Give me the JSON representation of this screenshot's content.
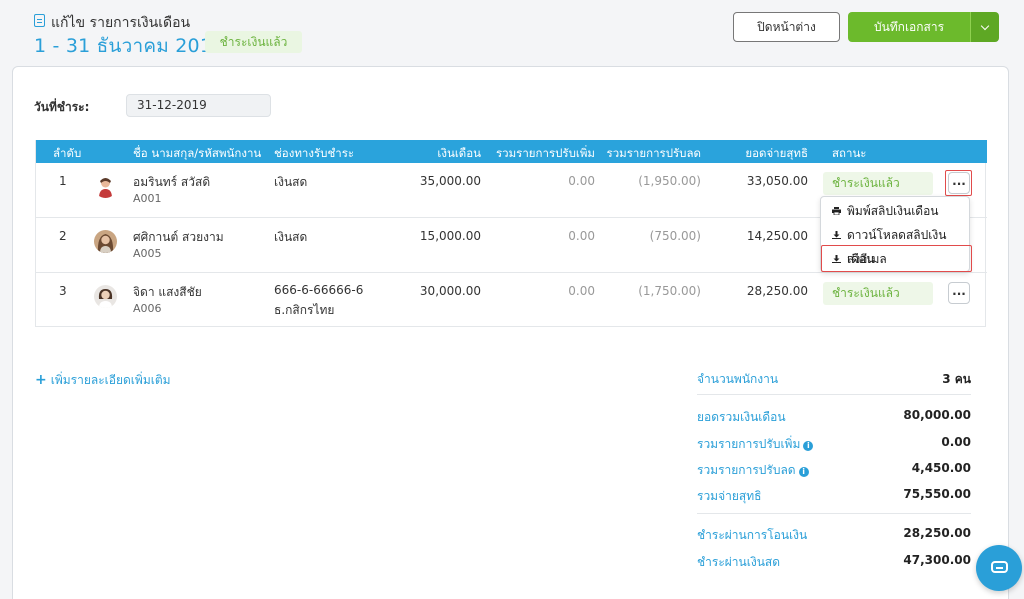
{
  "header": {
    "title": "แก้ไข รายการเงินเดือน",
    "period": "1 - 31 ธันวาคม 2019",
    "status": "ชำระเงินแล้ว",
    "close_label": "ปิดหน้าต่าง",
    "save_label": "บันทึกเอกสาร"
  },
  "payment": {
    "label": "วันที่ชำระ:",
    "date": "31-12-2019"
  },
  "table": {
    "columns": [
      "ลำดับ",
      "ชื่อ นามสกุล/รหัสพนักงาน",
      "ช่องทางรับชำระ",
      "เงินเดือน",
      "รวมรายการปรับเพิ่ม",
      "รวมรายการปรับลด",
      "ยอดจ่ายสุทธิ",
      "สถานะ"
    ],
    "rows": [
      {
        "no": "1",
        "name": "อมรินทร์ สวัสดิ",
        "code": "A001",
        "channel": "เงินสด",
        "channel2": "",
        "salary": "35,000.00",
        "add": "0.00",
        "deduct": "(1,950.00)",
        "net": "33,050.00",
        "status": "ชำระเงินแล้ว"
      },
      {
        "no": "2",
        "name": "ศศิกานต์ สวยงาม",
        "code": "A005",
        "channel": "เงินสด",
        "channel2": "",
        "salary": "15,000.00",
        "add": "0.00",
        "deduct": "(750.00)",
        "net": "14,250.00",
        "status": ""
      },
      {
        "no": "3",
        "name": "จิดา แสงสีชัย",
        "code": "A006",
        "channel": "666-6-66666-6",
        "channel2": "ธ.กสิกรไทย",
        "salary": "30,000.00",
        "add": "0.00",
        "deduct": "(1,750.00)",
        "net": "28,250.00",
        "status": "ชำระเงินแล้ว"
      }
    ],
    "more_label": "..."
  },
  "menu": {
    "items": [
      "พิมพ์สลิปเงินเดือน",
      "ดาวน์โหลดสลิปเงินเดือน",
      "ส่งอีเมล"
    ]
  },
  "add_more": "เพิ่มรายละเอียดเพิ่มเติม",
  "summary": {
    "employee_count_label": "จำนวนพนักงาน",
    "employee_count": "3 คน",
    "total_salary_label": "ยอดรวมเงินเดือน",
    "total_salary": "80,000.00",
    "total_add_label": "รวมรายการปรับเพิ่ม",
    "total_add": "0.00",
    "total_deduct_label": "รวมรายการปรับลด",
    "total_deduct": "4,450.00",
    "net_label": "รวมจ่ายสุทธิ",
    "net": "75,550.00",
    "transfer_label": "ชำระผ่านการโอนเงิน",
    "transfer": "28,250.00",
    "cash_label": "ชำระผ่านเงินสด",
    "cash": "47,300.00"
  },
  "colors": {
    "accent": "#2a9fd8",
    "success": "#6cba2c",
    "highlight": "#e14b4b"
  }
}
